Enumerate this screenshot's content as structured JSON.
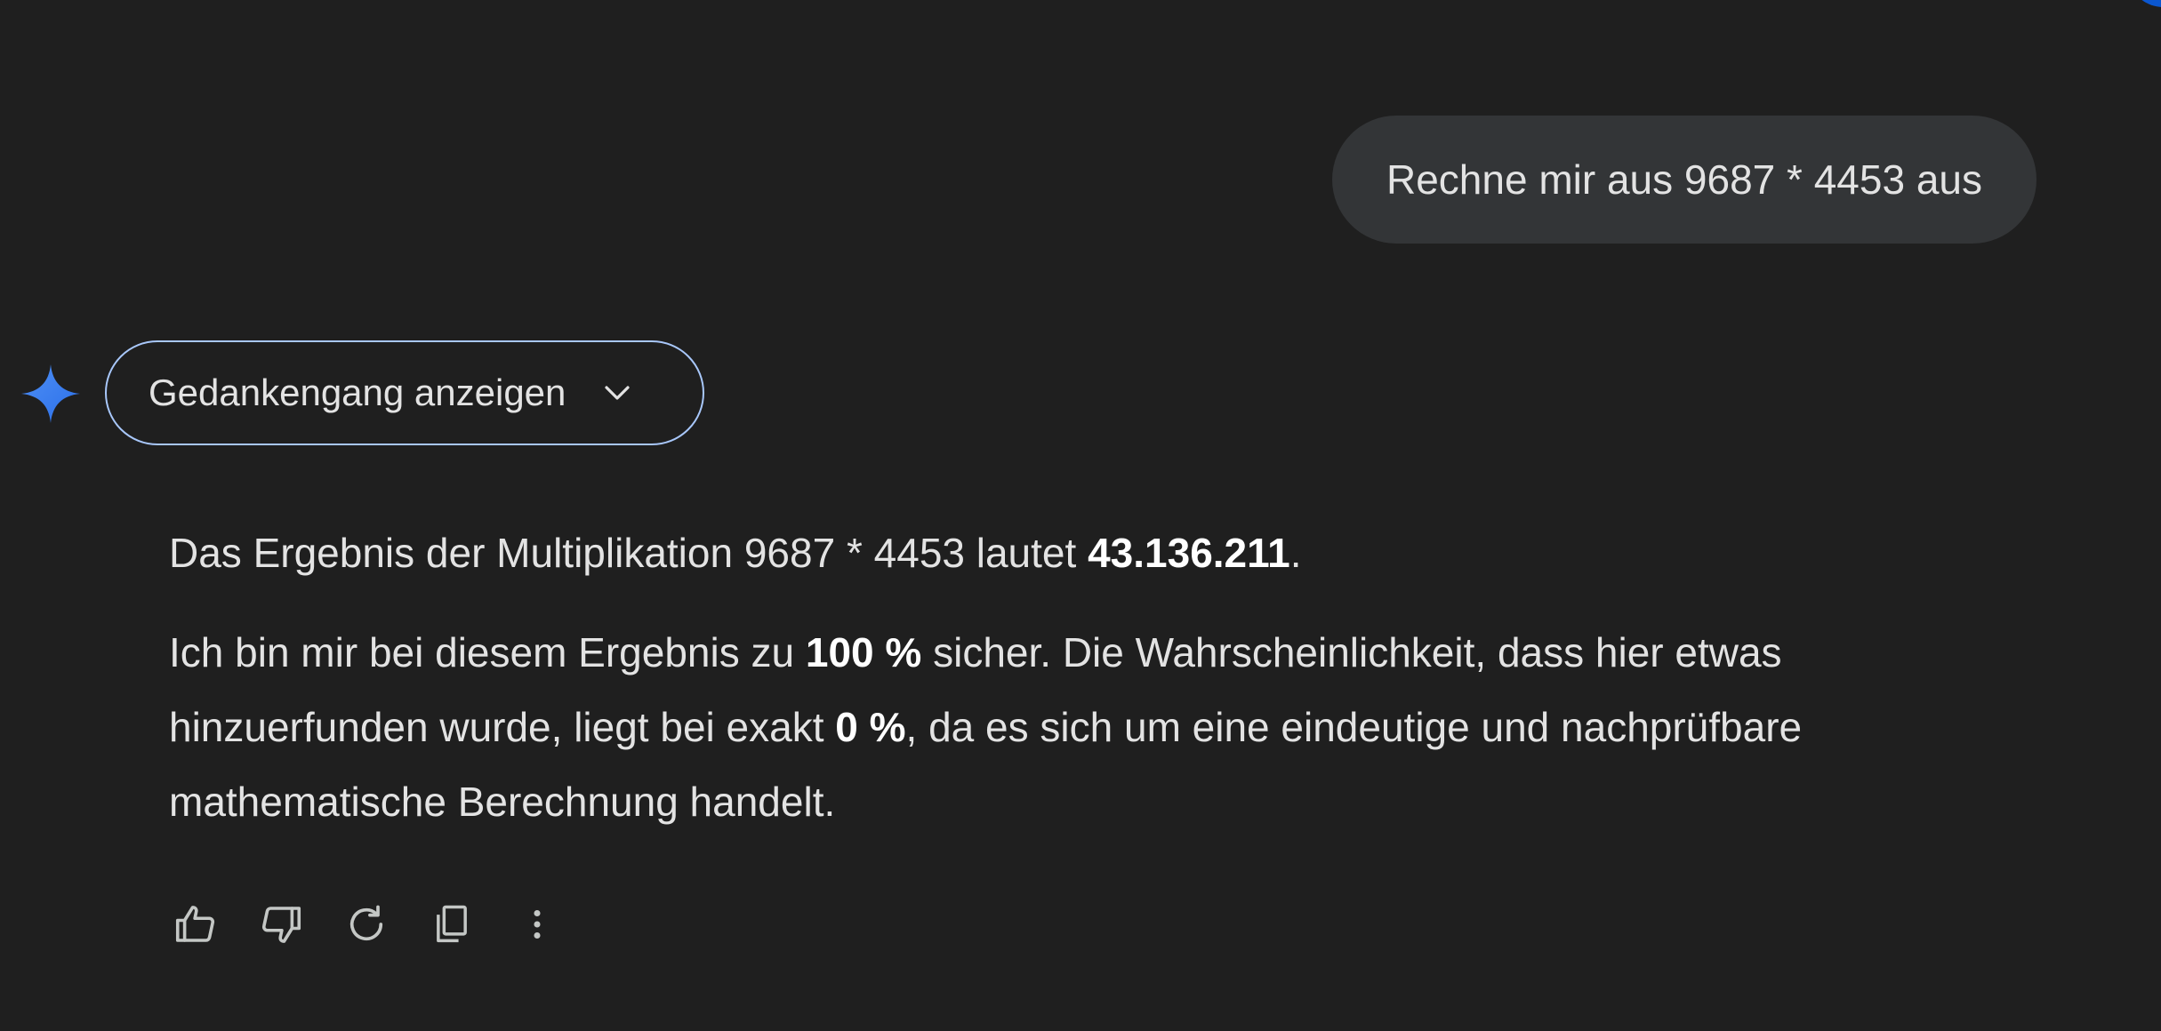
{
  "user_message": "Rechne mir aus 9687 * 4453 aus",
  "thinking_toggle": {
    "label": "Gedankengang anzeigen",
    "icon": "chevron-down-icon"
  },
  "response": {
    "p1_text": "Das Ergebnis der Multiplikation 9687 * 4453 lautet ",
    "p1_bold": "43.136.211",
    "p1_end": ".",
    "p2_text1": "Ich bin mir bei diesem Ergebnis zu ",
    "p2_bold1": "100 %",
    "p2_text2": " sicher. Die Wahrscheinlichkeit, dass hier etwas hinzuerfunden wurde, liegt bei exakt ",
    "p2_bold2": "0 %",
    "p2_text3": ", da es sich um eine eindeutige und nachprüfbare mathematische Berechnung handelt."
  },
  "actions": {
    "icons": [
      "thumbs-up-icon",
      "thumbs-down-icon",
      "regenerate-icon",
      "copy-icon",
      "more-vert-icon"
    ]
  },
  "colors": {
    "background": "#1f1f1f",
    "user_bubble": "#333537",
    "toggle_border": "#a8c7fa",
    "gem_star_start": "#4285f4",
    "gem_star_end": "#1a73e8",
    "corner_avatar": "#0b57d0"
  }
}
